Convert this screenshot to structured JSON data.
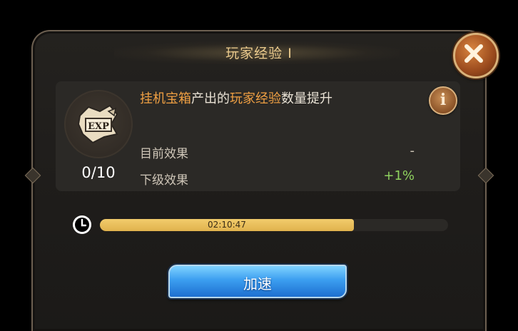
{
  "title": "玩家经验 Ⅰ",
  "icons": {
    "close": "close-x-icon",
    "info": "info-icon",
    "exp": "exp-scroll-icon",
    "clock": "clock-icon"
  },
  "effect": {
    "progress": "0/10",
    "description": {
      "part1": "挂机宝箱",
      "part2": "产出的",
      "part3": "玩家经验",
      "part4": "数量提升"
    },
    "current_label": "目前效果",
    "current_value": "-",
    "next_label": "下级效果",
    "next_value": "+1%"
  },
  "timer": {
    "text": "02:10:47",
    "fill_fraction": 0.73
  },
  "speedup_label": "加速",
  "colors": {
    "highlight": "#f0a043",
    "next_value": "#8fd25f",
    "bar_fill": "#e8bd58",
    "button": "#3c9ef0"
  }
}
